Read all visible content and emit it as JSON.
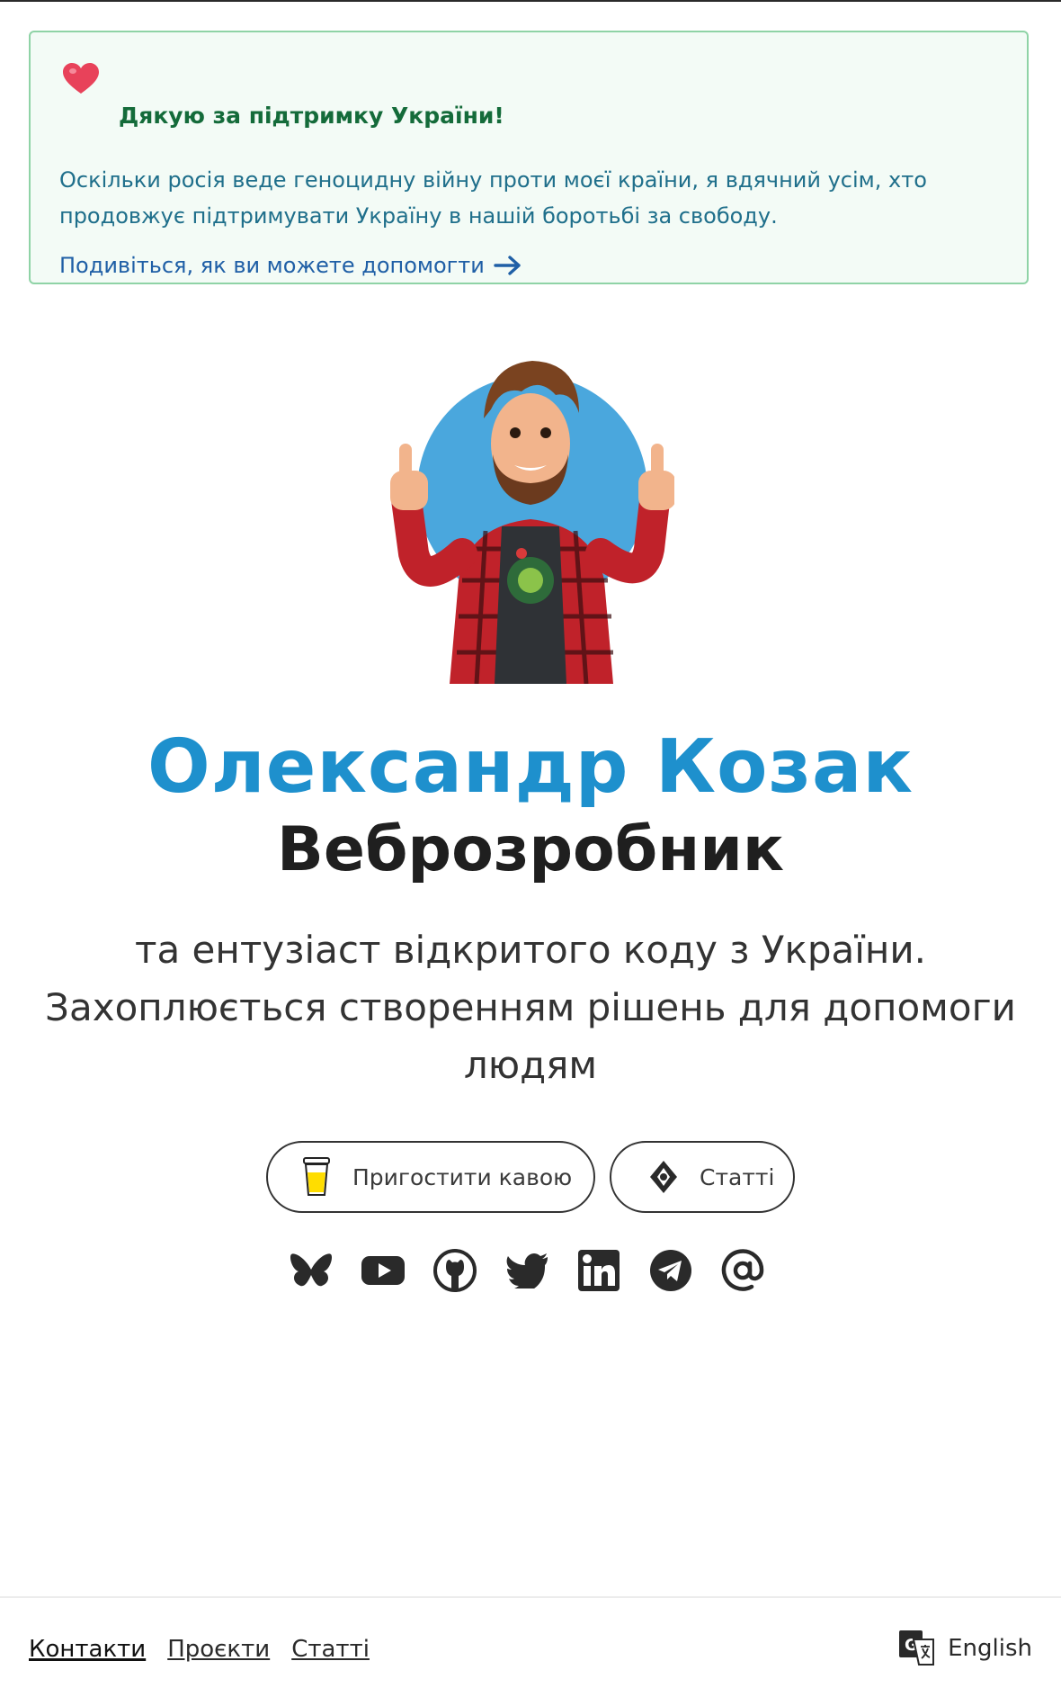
{
  "banner": {
    "title": "Дякую за підтримку України!",
    "text": "Оскільки росія веде геноцидну війну проти моєї країни, я вдячний усім, хто продовжує підтримувати Україну в нашій боротьбі за свободу.",
    "help_link": "Подивіться, як ви можете допомогти",
    "colors": {
      "border": "#8fd3a6",
      "title": "#146b3a",
      "text": "#1f6f8b",
      "link": "#1f5fa6"
    }
  },
  "profile": {
    "name": "Олександр Козак",
    "role": "Веброзробник",
    "description": "та ентузіаст відкритого коду з України. Захоплюється створенням рішень для допомоги людям"
  },
  "buttons": {
    "coffee": {
      "label": "Пригостити кавою",
      "icon": "coffee-cup-icon"
    },
    "articles": {
      "label": "Статті",
      "icon": "hashnode-icon"
    }
  },
  "socials": [
    {
      "name": "bluesky",
      "icon": "bluesky-icon"
    },
    {
      "name": "youtube",
      "icon": "youtube-icon"
    },
    {
      "name": "github",
      "icon": "github-icon"
    },
    {
      "name": "twitter",
      "icon": "twitter-icon"
    },
    {
      "name": "linkedin",
      "icon": "linkedin-icon"
    },
    {
      "name": "telegram",
      "icon": "telegram-icon"
    },
    {
      "name": "email",
      "icon": "at-sign-icon"
    }
  ],
  "footer": {
    "links": [
      "Контакти",
      "Проєкти",
      "Статті"
    ],
    "language": "English",
    "language_icon": "translate-icon"
  },
  "colors": {
    "name": "#1e90cd",
    "heart": "#e8425a"
  }
}
